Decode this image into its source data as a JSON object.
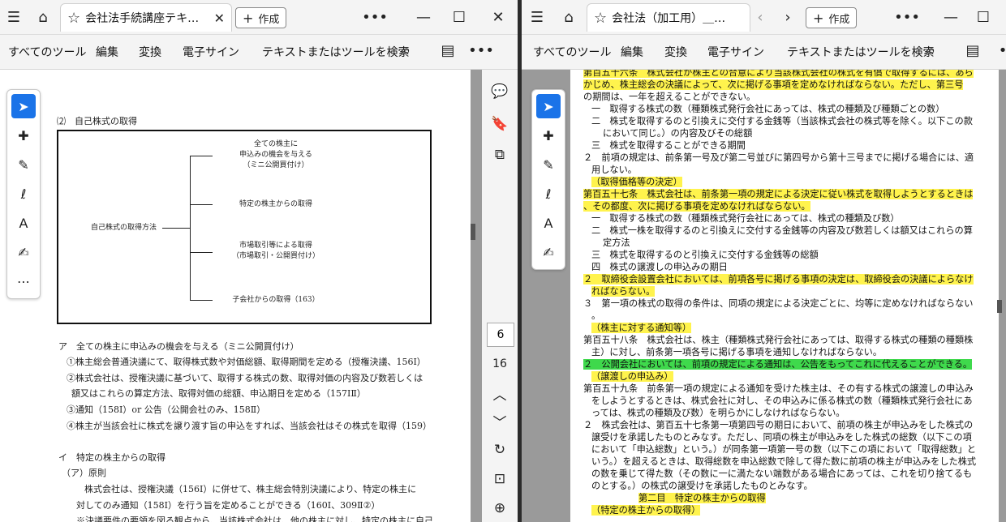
{
  "left": {
    "tab_title": "会社法手続講座テキ…",
    "create_label": "作成",
    "menu": [
      "すべてのツール",
      "編集",
      "変換",
      "電子サイン",
      "テキストまたはツールを検索"
    ],
    "doc": {
      "section": "⑵　自己株式の取得",
      "diagram": {
        "root": "自己株式の取得方法",
        "branch1": [
          "全ての株主に",
          "申込みの機会を与える",
          "（ミニ公開買付け）"
        ],
        "branch2": "特定の株主からの取得",
        "branch3": [
          "市場取引等による取得",
          "（市場取引・公開買付け）"
        ],
        "branch4": "子会社からの取得（163）"
      },
      "lines": [
        "ア　全ての株主に申込みの機会を与える（ミニ公開買付け）",
        "①株主総会普通決議にて、取得株式数や対価総額、取得期間を定める（授権決議、156Ⅰ）",
        "②株式会社は、授権決議に基づいて、取得する株式の数、取得対価の内容及び数若しくは",
        "額又はこれらの算定方法、取得対価の総額、申込期日を定める（157ⅠⅡ）",
        "③通知（158Ⅰ）or 公告（公開会社のみ、158Ⅱ）",
        "④株主が当該会社に株式を譲り渡す旨の申込をすれば、当該会社はその株式を取得（159）",
        "イ　特定の株主からの取得",
        "（ア）原則",
        "株式会社は、授権決議（156Ⅰ）に併せて、株主総会特別決議により、特定の株主に",
        "対してのみ通知（158Ⅰ）を行う旨を定めることができる（160Ⅰ、309Ⅱ②）",
        "※決議要件の要領を図る観点から、当該株式会社は、他の株主に対し、特定の株主に自己"
      ]
    },
    "rail": {
      "page": "6",
      "total": "16"
    }
  },
  "right": {
    "tab_title": "会社法（加工用）＿…",
    "create_label": "作成",
    "menu": [
      "すべてのツール",
      "編集",
      "変換",
      "電子サイン",
      "テキストまたはツールを検索"
    ],
    "lines": [
      "第百五十六条　株式会社が株主との合意により当該株式会社の株式を有償で取得するには、あら",
      "かじめ、株主総会の決議によって、次に掲げる事項を定めなければならない。ただし、第三号",
      "の期間は、一年を超えることができない。",
      "一　取得する株式の数（種類株式発行会社にあっては、株式の種類及び種類ごとの数）",
      "二　株式を取得するのと引換えに交付する金銭等（当該株式会社の株式等を除く。以下この款",
      "において同じ。）の内容及びその総額",
      "三　株式を取得することができる期間",
      "２　前項の規定は、前条第一号及び第二号並びに第四号から第十三号までに掲げる場合には、適",
      "用しない。",
      "（取得価格等の決定）",
      "第百五十七条　株式会社は、前条第一項の規定による決定に従い株式を取得しようとするときは",
      "、その都度、次に掲げる事項を定めなければならない。",
      "一　取得する株式の数（種類株式発行会社にあっては、株式の種類及び数）",
      "二　株式一株を取得するのと引換えに交付する金銭等の内容及び数若しくは額又はこれらの算",
      "定方法",
      "三　株式を取得するのと引換えに交付する金銭等の総額",
      "四　株式の譲渡しの申込みの期日",
      "２　取締役会設置会社においては、前項各号に掲げる事項の決定は、取締役会の決議によらなけ",
      "ればならない。",
      "３　第一項の株式の取得の条件は、同項の規定による決定ごとに、均等に定めなければならない",
      "。",
      "（株主に対する通知等）",
      "第百五十八条　株式会社は、株主（種類株式発行会社にあっては、取得する株式の種類の種類株",
      "主）に対し、前条第一項各号に掲げる事項を通知しなければならない。",
      "２　公開会社においては、前項の規定による通知は、公告をもってこれに代えることができる。",
      "（譲渡しの申込み）",
      "第百五十九条　前条第一項の規定による通知を受けた株主は、その有する株式の譲渡しの申込み",
      "をしようとするときは、株式会社に対し、その申込みに係る株式の数（種類株式発行会社にあ",
      "っては、株式の種類及び数）を明らかにしなければならない。",
      "２　株式会社は、第百五十七条第一項第四号の期日において、前項の株主が申込みをした株式の",
      "譲受けを承諾したものとみなす。ただし、同項の株主が申込みをした株式の総数（以下この項",
      "において「申込総数」という。）が同条第一項第一号の数（以下この項において「取得総数」と",
      "いう。）を超えるときは、取得総数を申込総数で除して得た数に前項の株主が申込みをした株式",
      "の数を乗じて得た数（その数に一に満たない端数がある場合にあっては、これを切り捨てるも",
      "のとする。）の株式の譲受けを承諾したものとみなす。",
      "第二目　特定の株主からの取得",
      "（特定の株主からの取得）"
    ]
  },
  "colors": {
    "highlight_yellow": "#fff34d",
    "highlight_green": "#3fd94c",
    "accent": "#1a73e8"
  }
}
